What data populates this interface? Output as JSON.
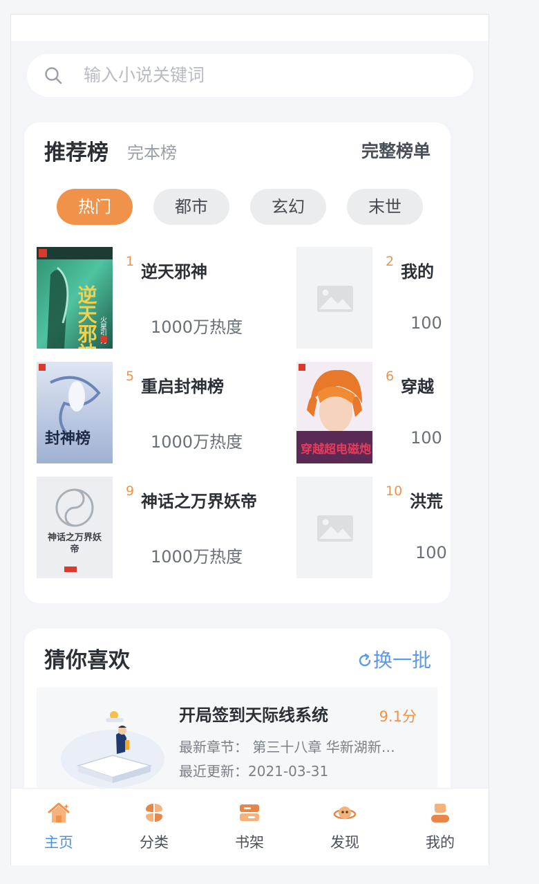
{
  "search": {
    "placeholder": "输入小说关键词"
  },
  "ranking": {
    "title": "推荐榜",
    "subtitle": "完本榜",
    "more": "完整榜单",
    "tabs": [
      "热门",
      "都市",
      "玄幻",
      "末世"
    ],
    "books": [
      {
        "rank": "1",
        "name": "逆天邪神",
        "heat": "1000万热度",
        "cover": "green"
      },
      {
        "rank": "2",
        "name": "我的",
        "heat": "100",
        "cover": "placeholder"
      },
      {
        "rank": "5",
        "name": "重启封神榜",
        "heat": "1000万热度",
        "cover": "blue"
      },
      {
        "rank": "6",
        "name": "穿越",
        "heat": "100",
        "cover": "orange"
      },
      {
        "rank": "9",
        "name": "神话之万界妖帝",
        "heat": "1000万热度",
        "cover": "grey"
      },
      {
        "rank": "10",
        "name": "洪荒",
        "heat": "100",
        "cover": "placeholder"
      }
    ],
    "cover_text": {
      "b1_title": "逆天邪神",
      "b1_author": "火星引力",
      "b3_title": "封神榜",
      "b4_title": "穿越超电磁炮",
      "b5_title": "神话之万界妖帝"
    }
  },
  "guess": {
    "title": "猜你喜欢",
    "refresh": "换一批",
    "item": {
      "name": "开局签到天际线系统",
      "score": "9.1分",
      "latest": "最新章节：  第三十八章 华新湖新…",
      "updated": "最近更新：2021-03-31"
    }
  },
  "nav": [
    {
      "label": "主页",
      "icon": "home-icon",
      "active": true
    },
    {
      "label": "分类",
      "icon": "category-icon",
      "active": false
    },
    {
      "label": "书架",
      "icon": "bookshelf-icon",
      "active": false
    },
    {
      "label": "发现",
      "icon": "discover-icon",
      "active": false
    },
    {
      "label": "我的",
      "icon": "profile-icon",
      "active": false
    }
  ],
  "colors": {
    "accent": "#f0924a",
    "link": "#5d9ae6",
    "nav_active": "#4a90e2"
  }
}
